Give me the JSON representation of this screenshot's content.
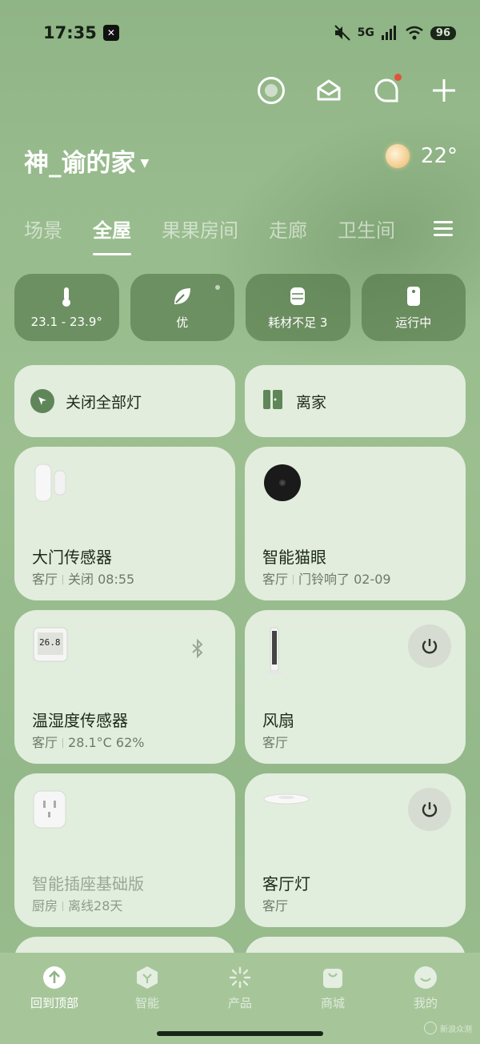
{
  "status_bar": {
    "time": "17:35",
    "network": "5G",
    "battery": "96"
  },
  "home": {
    "title": "神_谕的家",
    "temperature": "22°"
  },
  "tabs": [
    {
      "label": "场景"
    },
    {
      "label": "全屋"
    },
    {
      "label": "果果房间"
    },
    {
      "label": "走廊"
    },
    {
      "label": "卫生间"
    }
  ],
  "chips": [
    {
      "label": "23.1 - 23.9°",
      "icon": "thermometer-icon"
    },
    {
      "label": "优",
      "icon": "leaf-icon"
    },
    {
      "label": "耗材不足 3",
      "icon": "filter-icon"
    },
    {
      "label": "运行中",
      "icon": "device-icon"
    }
  ],
  "scenes": [
    {
      "label": "关闭全部灯",
      "icon": "cursor-icon"
    },
    {
      "label": "离家",
      "icon": "door-icon"
    }
  ],
  "devices": [
    {
      "name": "大门传感器",
      "room": "客厅",
      "status": "关闭 08:55"
    },
    {
      "name": "智能猫眼",
      "room": "客厅",
      "status": "门铃响了 02-09"
    },
    {
      "name": "温湿度传感器",
      "room": "客厅",
      "status": "28.1°C 62%",
      "display": "26.8"
    },
    {
      "name": "风扇",
      "room": "客厅"
    },
    {
      "name": "智能插座基础版",
      "room": "厨房",
      "status": "离线28天"
    },
    {
      "name": "客厅灯",
      "room": "客厅"
    }
  ],
  "bottom_nav": [
    {
      "label": "回到顶部",
      "icon": "arrow-up-icon"
    },
    {
      "label": "智能",
      "icon": "smart-icon"
    },
    {
      "label": "产品",
      "icon": "product-icon"
    },
    {
      "label": "商城",
      "icon": "shop-icon"
    },
    {
      "label": "我的",
      "icon": "profile-icon"
    }
  ],
  "watermark": "新浪众测"
}
